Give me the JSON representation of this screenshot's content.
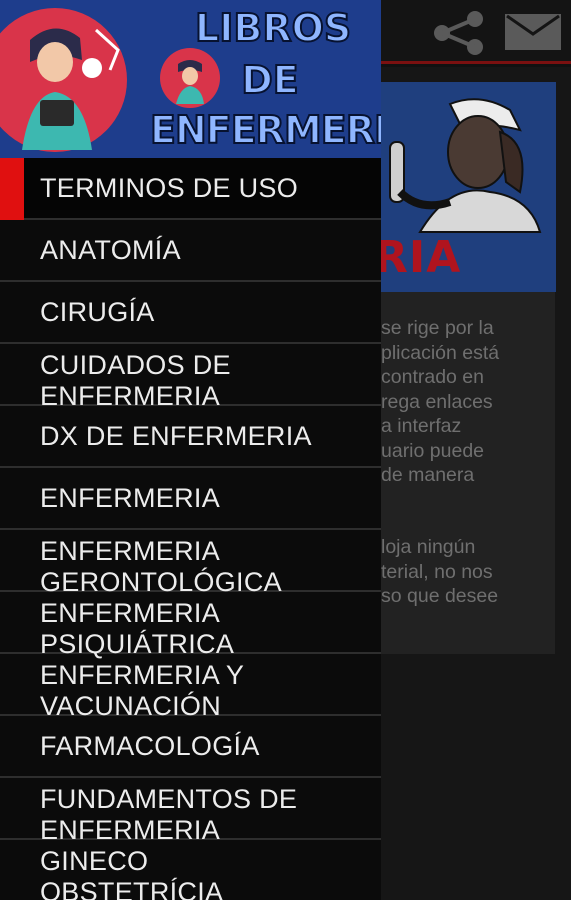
{
  "header": {
    "title_lines": [
      "LIBROS",
      "DE",
      "ENFERMERIA"
    ],
    "share_icon": "share-icon",
    "mail_icon": "mail-icon"
  },
  "menu": {
    "active_index": 0,
    "items": [
      {
        "label": "TERMINOS DE USO"
      },
      {
        "label": "ANATOMÍA"
      },
      {
        "label": "CIRUGÍA"
      },
      {
        "label": "CUIDADOS DE\nENFERMERIA"
      },
      {
        "label": "DX DE ENFERMERIA"
      },
      {
        "label": "ENFERMERIA"
      },
      {
        "label": "ENFERMERIA\nGERONTOLÓGICA"
      },
      {
        "label": "ENFERMERIA\nPSIQUIÁTRICA"
      },
      {
        "label": "ENFERMERIA Y\nVACUNACIÓN"
      },
      {
        "label": "FARMACOLOGÍA"
      },
      {
        "label": "FUNDAMENTOS DE\nENFERMERIA"
      },
      {
        "label": "GINECO\nOBSTETRÍCIA"
      }
    ]
  },
  "background": {
    "banner_word": "RIA",
    "paragraph1": [
      "se rige por la",
      "plicación está",
      "contrado en",
      "rega enlaces",
      "a interfaz",
      "uario puede",
      "de manera"
    ],
    "paragraph2": [
      "loja ningún",
      "terial, no nos",
      "so que desee"
    ]
  },
  "colors": {
    "accent": "#e01010",
    "header_bg": "#1e3d8c",
    "drawer_bg": "#0b0b0b"
  }
}
